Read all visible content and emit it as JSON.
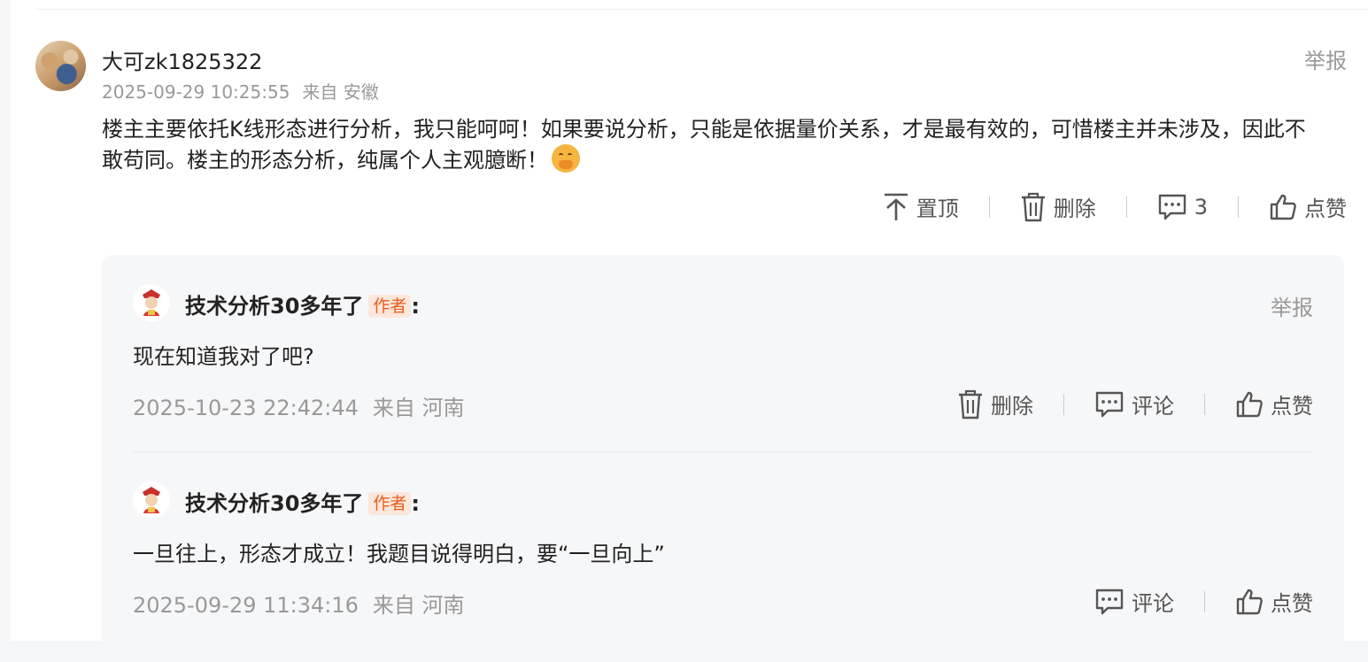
{
  "main_comment": {
    "user_name": "大可zk1825322",
    "timestamp": "2025-09-29 10:25:55",
    "location": "来自 安徽",
    "report_label": "举报",
    "text_line1": "楼主主要依托K线形态进行分析，我只能呵呵！如果要说分析，只能是依据量价关系，才是最有效的，可惜楼主并未涉及，因此不",
    "text_line2": "敢苟同。楼主的形态分析，纯属个人主观臆断！",
    "emoji_icon": "covering-mouth-emoji-icon",
    "actions": {
      "pin_label": "置顶",
      "delete_label": "删除",
      "reply_count": "3",
      "like_label": "点赞"
    }
  },
  "replies": [
    {
      "author": "技术分析30多年了",
      "tag": "作者",
      "colon": ":",
      "report_label": "举报",
      "text": "现在知道我对了吧?",
      "timestamp": "2025-10-23 22:42:44",
      "location": "来自 河南",
      "delete_label": "删除",
      "comment_label": "评论",
      "like_label": "点赞"
    },
    {
      "author": "技术分析30多年了",
      "tag": "作者",
      "colon": ":",
      "text": "一旦往上，形态才成立！我题目说得明白，要“一旦向上”",
      "timestamp": "2025-09-29 11:34:16",
      "location": "来自 河南",
      "comment_label": "评论",
      "like_label": "点赞"
    }
  ],
  "colors": {
    "author_tag_text": "#e85f1c",
    "author_tag_bg": "#fde7dc",
    "muted_text": "#999999",
    "reply_panel_bg": "#f6f7f9"
  }
}
